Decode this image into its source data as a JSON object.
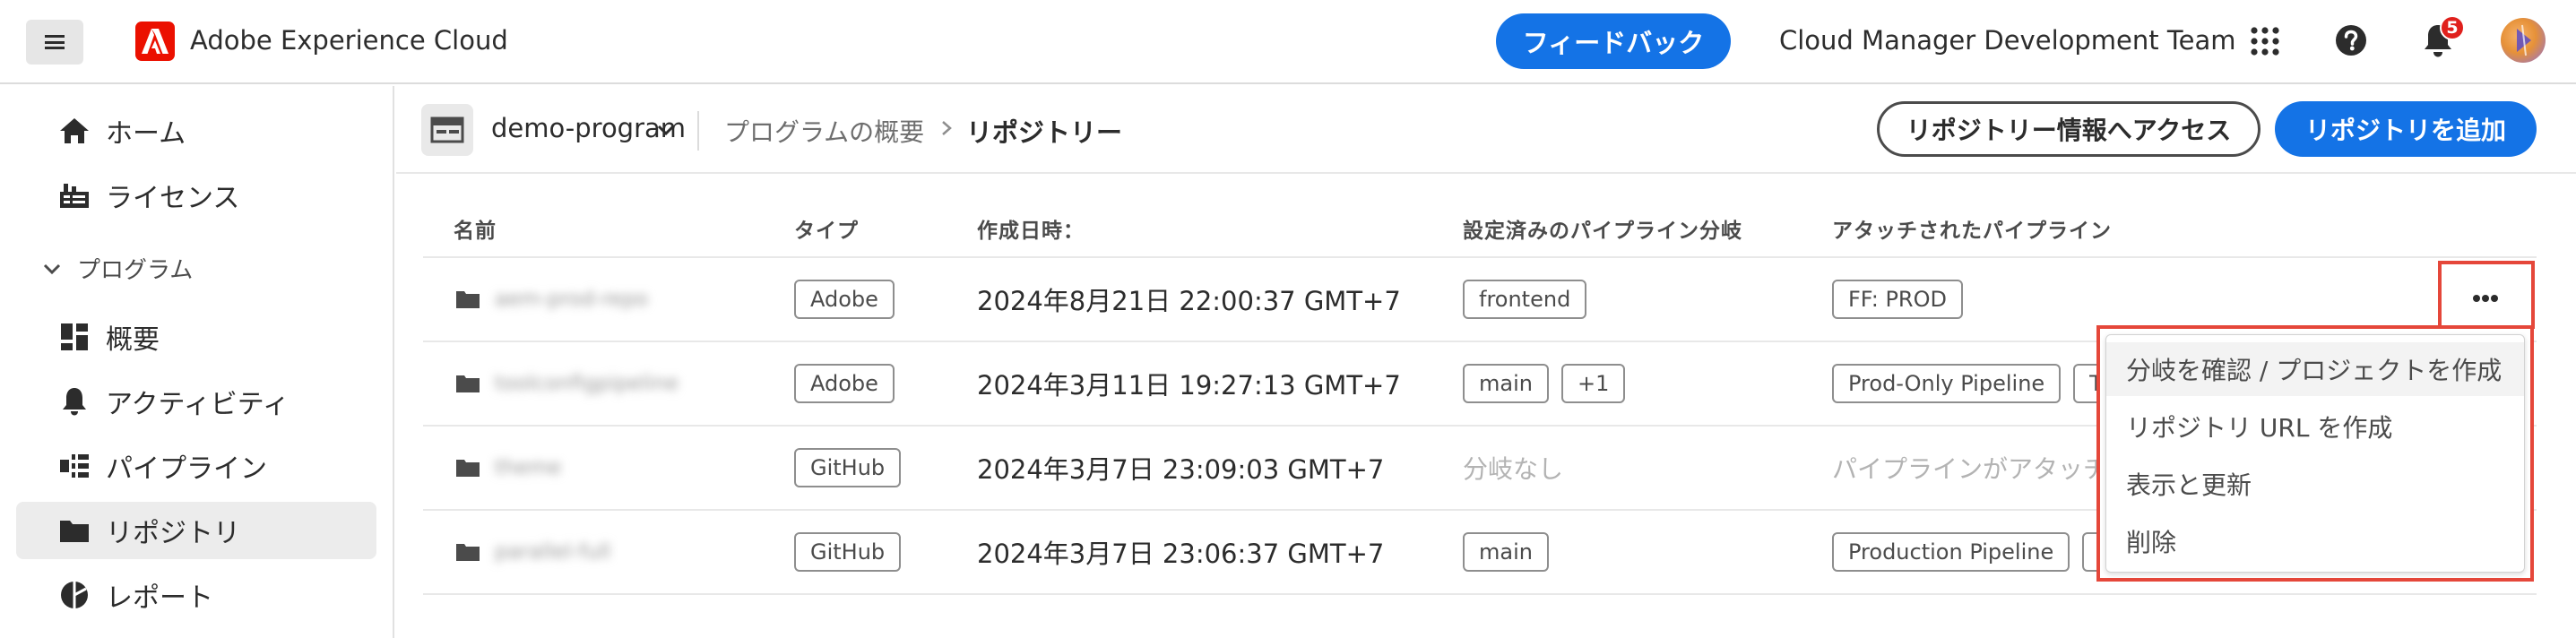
{
  "topbar": {
    "app_title": "Adobe Experience Cloud",
    "feedback_label": "フィードバック",
    "org_name": "Cloud Manager Development Team",
    "notification_count": "5"
  },
  "sidebar": {
    "items": [
      {
        "label": "ホーム",
        "icon": "home-icon"
      },
      {
        "label": "ライセンス",
        "icon": "license-icon"
      }
    ],
    "group_label": "プログラム",
    "group_items": [
      {
        "label": "概要",
        "icon": "dashboard-icon"
      },
      {
        "label": "アクティビティ",
        "icon": "bell-icon"
      },
      {
        "label": "パイプライン",
        "icon": "pipeline-icon"
      },
      {
        "label": "リポジトリ",
        "icon": "folder-icon"
      },
      {
        "label": "レポート",
        "icon": "report-icon"
      }
    ]
  },
  "header": {
    "program_name": "demo-program",
    "breadcrumb_parent": "プログラムの概要",
    "breadcrumb_current": "リポジトリー",
    "access_button": "リポジトリー情報へアクセス",
    "add_button": "リポジトリを追加"
  },
  "table": {
    "columns": [
      "名前",
      "タイプ",
      "作成日時：",
      "設定済みのパイプライン分岐",
      "アタッチされたパイプライン"
    ],
    "rows": [
      {
        "name": "aem-prod-repo",
        "type": "Adobe",
        "created": "2024年8月21日 22:00:37 GMT+7",
        "branches": [
          "frontend"
        ],
        "branches_empty": "",
        "pipelines": [
          "FF: PROD"
        ],
        "pipelines_empty": ""
      },
      {
        "name": "toolconfigpipeline",
        "type": "Adobe",
        "created": "2024年3月11日 19:27:13 GMT+7",
        "branches": [
          "main",
          "+1"
        ],
        "branches_empty": "",
        "pipelines": [
          "Prod-Only Pipeline",
          "T"
        ],
        "pipelines_empty": ""
      },
      {
        "name": "theme",
        "type": "GitHub",
        "created": "2024年3月7日 23:09:03 GMT+7",
        "branches": [],
        "branches_empty": "分岐なし",
        "pipelines": [],
        "pipelines_empty": "パイプラインがアタッチ"
      },
      {
        "name": "parallel-full",
        "type": "GitHub",
        "created": "2024年3月7日 23:06:37 GMT+7",
        "branches": [
          "main"
        ],
        "branches_empty": "",
        "pipelines": [
          "Production Pipeline",
          ""
        ],
        "pipelines_empty": ""
      }
    ]
  },
  "menu": {
    "items": [
      "分岐を確認 / プロジェクトを作成",
      "リポジトリ URL を作成",
      "表示と更新",
      "削除"
    ]
  },
  "colors": {
    "accent": "#1473e6",
    "highlight": "#e5473a",
    "adobe_red": "#eb1000"
  }
}
